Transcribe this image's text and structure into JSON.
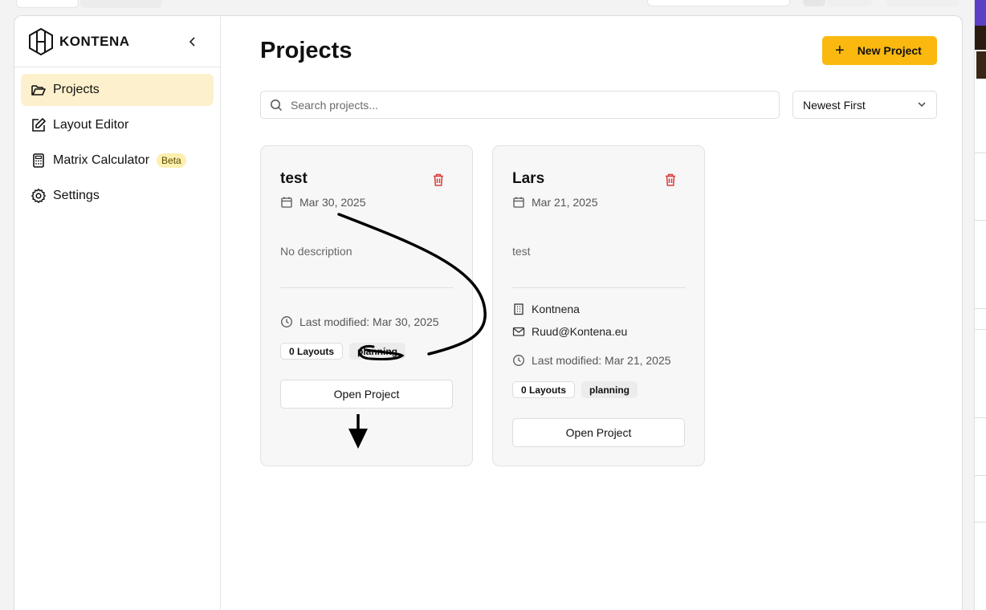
{
  "brand": {
    "name": "KONTENA"
  },
  "sidebar": {
    "items": [
      {
        "label": "Projects",
        "icon": "folder-open-icon",
        "active": true
      },
      {
        "label": "Layout Editor",
        "icon": "edit-icon"
      },
      {
        "label": "Matrix Calculator",
        "icon": "calculator-icon",
        "badge": "Beta"
      },
      {
        "label": "Settings",
        "icon": "gear-icon"
      }
    ]
  },
  "header": {
    "title": "Projects",
    "new_project_label": "New Project"
  },
  "search": {
    "placeholder": "Search projects..."
  },
  "sort": {
    "selected": "Newest First"
  },
  "projects": [
    {
      "name": "test",
      "date": "Mar 30, 2025",
      "description": "No description",
      "last_modified": "Last modified: Mar 30, 2025",
      "layouts": "0 Layouts",
      "status": "planning",
      "open_label": "Open Project"
    },
    {
      "name": "Lars",
      "date": "Mar 21, 2025",
      "description": "test",
      "company": "Kontnena",
      "email": "Ruud@Kontena.eu",
      "last_modified": "Last modified: Mar 21, 2025",
      "layouts": "0 Layouts",
      "status": "planning",
      "open_label": "Open Project"
    }
  ],
  "colors": {
    "accent": "#fbb80f",
    "active_nav": "#fdf0cc",
    "danger": "#d93a3a"
  }
}
